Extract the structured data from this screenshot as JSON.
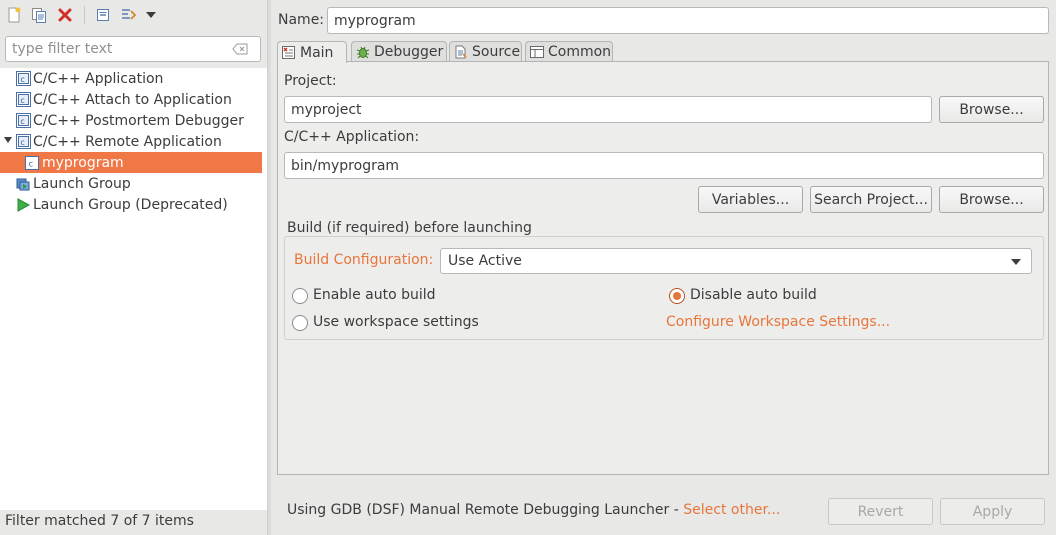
{
  "left": {
    "toolbar": {
      "new": "new-launch-configuration-icon",
      "duplicate": "duplicate-icon",
      "delete": "delete-icon",
      "collapse": "collapse-all-icon",
      "filter": "filter-icon",
      "menu": "view-menu-icon"
    },
    "filter": {
      "placeholder": "type filter text",
      "value": ""
    },
    "tree": [
      {
        "label": "C/C++ Application"
      },
      {
        "label": "C/C++ Attach to Application"
      },
      {
        "label": "C/C++ Postmortem Debugger"
      },
      {
        "label": "C/C++ Remote Application"
      },
      {
        "label": "myprogram"
      },
      {
        "label": "Launch Group"
      },
      {
        "label": "Launch Group (Deprecated)"
      }
    ],
    "status": "Filter matched 7 of 7 items"
  },
  "right": {
    "name_label": "Name:",
    "name_value": "myprogram",
    "tabs": [
      {
        "label": "Main"
      },
      {
        "label": "Debugger"
      },
      {
        "label": "Source"
      },
      {
        "label": "Common"
      }
    ],
    "main": {
      "project_label": "Project:",
      "project_value": "myproject",
      "browse1": "Browse...",
      "app_label": "C/C++ Application:",
      "app_value": "bin/myprogram",
      "variables": "Variables...",
      "search_project": "Search Project...",
      "browse2": "Browse...",
      "build_group_title": "Build (if required) before launching",
      "build_config_label": "Build Configuration:",
      "build_config_value": "Use Active",
      "enable_auto_build": "Enable auto build",
      "disable_auto_build": "Disable auto build",
      "use_workspace": "Use workspace settings",
      "configure_workspace": "Configure Workspace Settings..."
    },
    "footer": {
      "launcher_text": "Using GDB (DSF) Manual Remote Debugging Launcher - ",
      "select_other": "Select other...",
      "revert": "Revert",
      "apply": "Apply"
    }
  },
  "colors": {
    "accent": "#f07746",
    "link": "#e8753b"
  }
}
